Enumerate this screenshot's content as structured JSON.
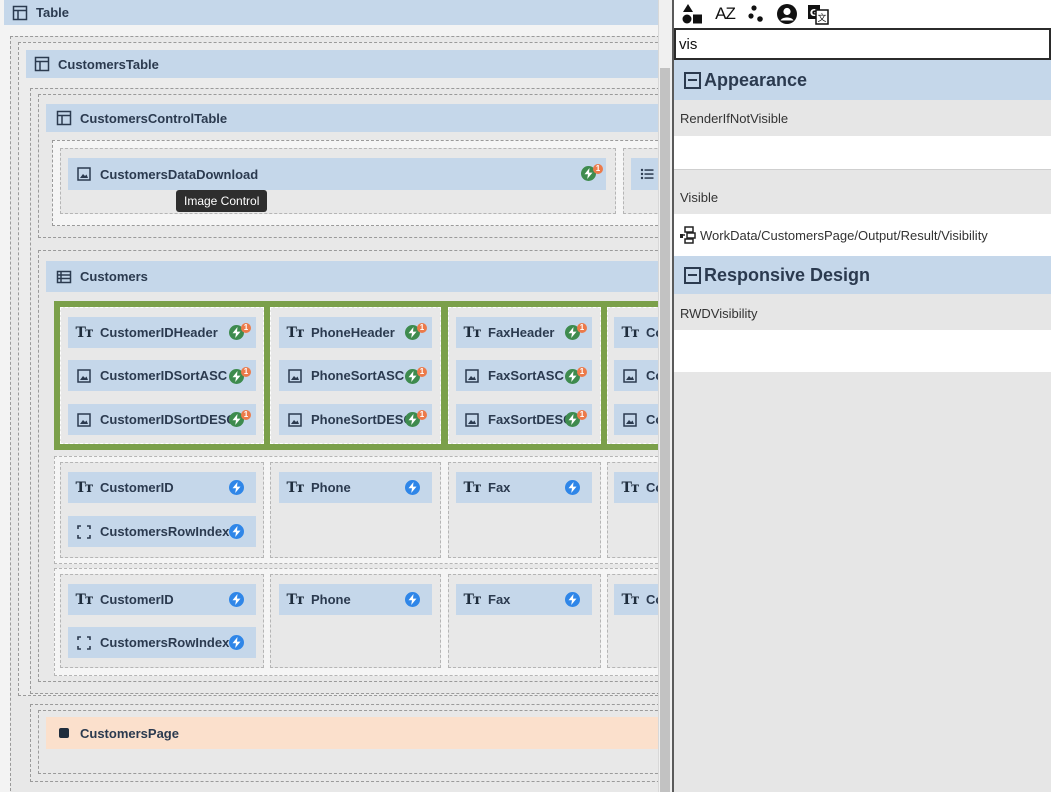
{
  "designer": {
    "table_label": "Table",
    "customers_table": "CustomersTable",
    "customers_control_table": "CustomersControlTable",
    "customers_data_download": "CustomersDataDownload",
    "tooltip": "Image Control",
    "customers_list": "Customers",
    "header_row": {
      "customer_id_header": "CustomerIDHeader",
      "customer_id_sort_asc": "CustomerIDSortASC",
      "customer_id_sort_desc": "CustomerIDSortDESC",
      "phone_header": "PhoneHeader",
      "phone_sort_asc": "PhoneSortASC",
      "phone_sort_desc": "PhoneSortDESC",
      "fax_header": "FaxHeader",
      "fax_sort_asc": "FaxSortASC",
      "fax_sort_desc": "FaxSortDESC",
      "cut_prefix": "Co"
    },
    "data_row": {
      "customer_id": "CustomerID",
      "row_index": "CustomersRowIndex",
      "phone": "Phone",
      "fax": "Fax",
      "cut_prefix": "Co"
    },
    "badge_count": "1",
    "customers_page": "CustomersPage",
    "colors": {
      "header_blue": "#c5d7ea",
      "selection_green": "#7ba04a",
      "bolt_green": "#3e8b4e",
      "bolt_blue": "#2f86e8",
      "badge_orange": "#ec7a4a",
      "page_peach": "#fbe0cc"
    }
  },
  "toolbar": {
    "icons": [
      "shapes-icon",
      "sort-az-icon",
      "dots-icon",
      "user-circle-icon",
      "translate-icon"
    ],
    "az_label": "AZ"
  },
  "properties": {
    "search_value": "vis",
    "sections": {
      "appearance": "Appearance",
      "responsive": "Responsive Design"
    },
    "render_if_not_visible": "RenderIfNotVisible",
    "visible": "Visible",
    "visible_binding": "WorkData/CustomersPage/Output/Result/Visibility",
    "rwd_visibility": "RWDVisibility"
  }
}
